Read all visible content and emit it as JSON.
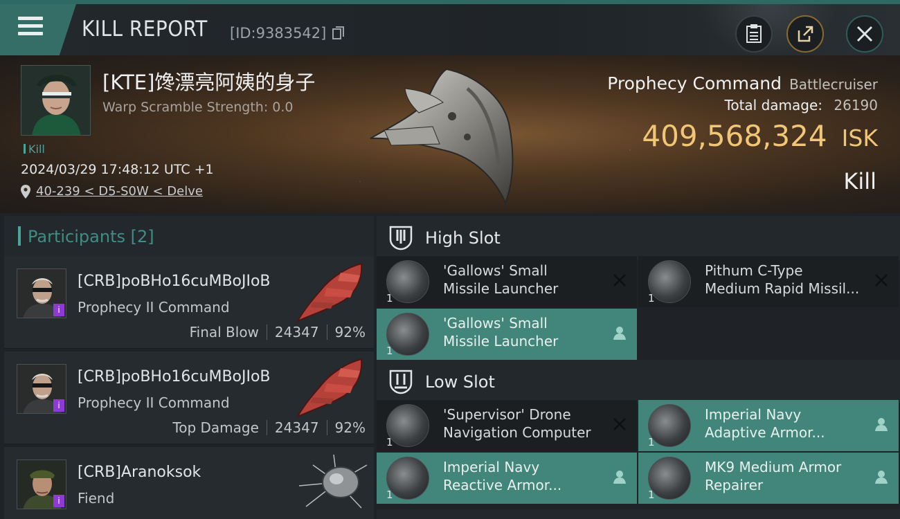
{
  "header": {
    "title": "KILL REPORT",
    "id_text": "[ID:9383542]",
    "icons": [
      "menu-icon",
      "copy-icon",
      "clipboard-icon",
      "share-icon",
      "close-icon"
    ]
  },
  "victim": {
    "name": "[KTE]馋漂亮阿姨的身子",
    "warp_scramble": "Warp Scramble Strength: 0.0",
    "tag": "Kill",
    "timestamp": "2024/03/29 17:48:12 UTC +1",
    "location": "40-239 < D5-S0W < Delve"
  },
  "ship": {
    "name": "Prophecy Command",
    "class": "Battlecruiser",
    "damage_label": "Total damage:",
    "damage_value": "26190",
    "isk_value": "409,568,324",
    "isk_unit": "ISK",
    "outcome": "Kill"
  },
  "participants": {
    "title": "Participants [2]",
    "rows": [
      {
        "name": "[CRB]poBHo16cuMBoJIoB",
        "ship": "Prophecy II Command",
        "role": "Final Blow",
        "damage": "24347",
        "percent": "92%"
      },
      {
        "name": "[CRB]poBHo16cuMBoJIoB",
        "ship": "Prophecy II Command",
        "role": "Top Damage",
        "damage": "24347",
        "percent": "92%"
      },
      {
        "name": "[CRB]Aranoksok",
        "ship": "Fiend"
      }
    ]
  },
  "fitting": {
    "high_slot": {
      "title": "High Slot",
      "modules": [
        {
          "line1": "'Gallows' Small",
          "line2": "Missile Launcher",
          "qty": "1",
          "status": "destroyed-icon"
        },
        {
          "line1": "Pithum C-Type",
          "line2": "Medium Rapid Missil...",
          "qty": "1",
          "status": "destroyed-icon"
        },
        {
          "line1": "'Gallows' Small",
          "line2": "Missile Launcher",
          "qty": "1",
          "status": "dropped-icon"
        }
      ]
    },
    "low_slot": {
      "title": "Low Slot",
      "modules": [
        {
          "line1": "'Supervisor' Drone",
          "line2": "Navigation Computer",
          "qty": "1",
          "status": "destroyed-icon"
        },
        {
          "line1": "Imperial Navy",
          "line2": "Adaptive Armor...",
          "qty": "1",
          "status": "dropped-icon"
        },
        {
          "line1": "Imperial Navy",
          "line2": "Reactive Armor...",
          "qty": "1",
          "status": "dropped-icon"
        },
        {
          "line1": "MK9 Medium Armor",
          "line2": "Repairer",
          "qty": "1",
          "status": "dropped-icon"
        }
      ]
    }
  },
  "colors": {
    "accent_teal": "#41857b",
    "isk_gold": "#f1c777",
    "participant_badge": "#8d3bd2"
  }
}
